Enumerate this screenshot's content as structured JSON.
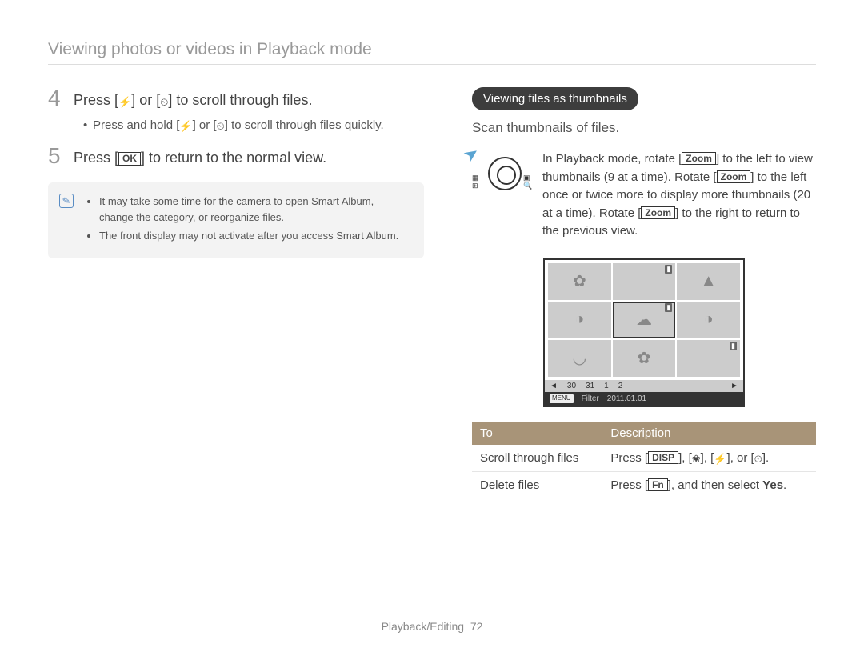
{
  "header": {
    "title": "Viewing photos or videos in Playback mode"
  },
  "left": {
    "step4": {
      "num": "4",
      "prefix": "Press [",
      "icon1_name": "flash-left-icon",
      "icon1": "⚡",
      "mid1": "] or [",
      "icon2_name": "timer-right-icon",
      "icon2": "⏲",
      "suffix": "] to scroll through files."
    },
    "step4_sub": {
      "prefix": "Press and hold [",
      "icon1": "⚡",
      "mid1": "] or [",
      "icon2": "⏲",
      "suffix": "] to scroll through files quickly."
    },
    "step5": {
      "num": "5",
      "prefix": "Press [",
      "ok": "OK",
      "suffix": "] to return to the normal view."
    },
    "note": {
      "item1": "It may take some time for the camera to open Smart Album, change the category, or reorganize files.",
      "item2": "The front display may not activate after you access Smart Album."
    }
  },
  "right": {
    "heading": "Viewing files as thumbnails",
    "subheading": "Scan thumbnails of files.",
    "zoom": {
      "part1": "In Playback mode, rotate [",
      "zoom1": "Zoom",
      "part2": "] to the left to view thumbnails (9 at a time). Rotate [",
      "zoom2": "Zoom",
      "part3": "] to the left once or twice more to display more thumbnails (20 at a time). Rotate [",
      "zoom3": "Zoom",
      "part4": "] to the right to return to the previous view."
    },
    "knob_left_top": "▦",
    "knob_left_bottom": "⊞",
    "knob_right_top": "▣",
    "knob_right_bottom": "🔍",
    "thumb_bar": {
      "v1": "30",
      "v2": "31",
      "v3": "1",
      "v4": "2"
    },
    "thumb_bar2": {
      "menu": "MENU",
      "filter": "Filter",
      "date": "2011.01.01"
    },
    "table": {
      "h1": "To",
      "h2": "Description",
      "r1c1": "Scroll through files",
      "r1c2_prefix": "Press [",
      "r1c2_disp": "DISP",
      "r1c2_m1": "], [",
      "r1c2_macro": "❀",
      "r1c2_m2": "], [",
      "r1c2_flash": "⚡",
      "r1c2_m3": "], or [",
      "r1c2_timer": "⏲",
      "r1c2_suffix": "].",
      "r2c1": "Delete files",
      "r2c2_prefix": "Press [",
      "r2c2_fn": "Fn",
      "r2c2_mid": "], and then select ",
      "r2c2_yes": "Yes",
      "r2c2_suffix": "."
    }
  },
  "footer": {
    "section": "Playback/Editing",
    "page": "72"
  }
}
